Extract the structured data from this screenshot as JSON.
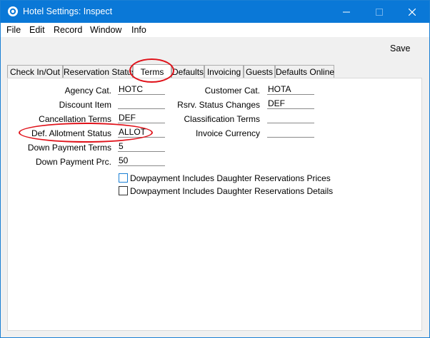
{
  "window": {
    "title": "Hotel Settings: Inspect"
  },
  "menubar": {
    "items": [
      "File",
      "Edit",
      "Record",
      "Window",
      "Info"
    ]
  },
  "toolbar": {
    "save_label": "Save"
  },
  "tabs": [
    "Check In/Out",
    "Reservation Status",
    "Terms",
    "Defaults",
    "Invoicing",
    "Guests",
    "Defaults Online"
  ],
  "active_tab": "Terms",
  "form": {
    "left": [
      {
        "label": "Agency Cat.",
        "value": "HOTC"
      },
      {
        "label": "Discount Item",
        "value": ""
      },
      {
        "label": "Cancellation Terms",
        "value": "DEF"
      },
      {
        "label": "Def. Allotment Status",
        "value": "ALLOT"
      },
      {
        "label": "Down Payment Terms",
        "value": "5"
      },
      {
        "label": "Down Payment Prc.",
        "value": "50"
      }
    ],
    "right": [
      {
        "label": "Customer Cat.",
        "value": "HOTA"
      },
      {
        "label": "Rsrv. Status Changes",
        "value": "DEF"
      },
      {
        "label": "Classification Terms",
        "value": ""
      },
      {
        "label": "Invoice Currency",
        "value": ""
      }
    ],
    "checkboxes": [
      {
        "label": "Dowpayment Includes Daughter Reservations Prices",
        "checked": false
      },
      {
        "label": "Dowpayment Includes Daughter Reservations Details",
        "checked": false
      }
    ]
  },
  "colors": {
    "titlebar": "#0a78d7",
    "annotation": "#e0121a"
  },
  "icons": {
    "app": "app-icon",
    "minimize": "minimize-icon",
    "maximize": "maximize-icon",
    "close": "close-icon"
  }
}
